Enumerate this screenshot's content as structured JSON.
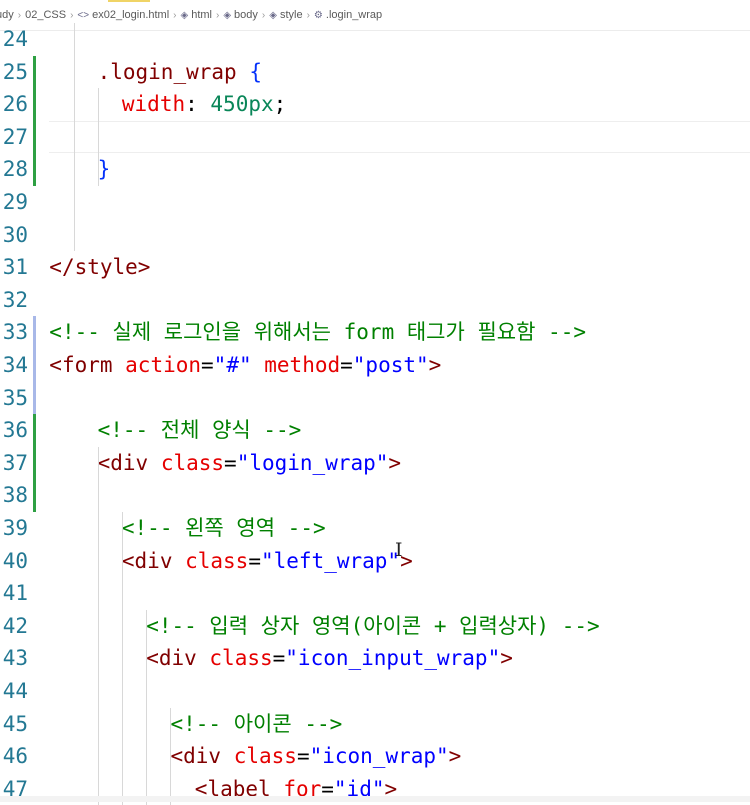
{
  "breadcrumb": {
    "items": [
      "udy",
      "02_CSS",
      "ex02_login.html",
      "html",
      "body",
      "style",
      ".login_wrap"
    ],
    "icons": [
      "",
      "",
      "html-file-icon",
      "element-icon",
      "element-icon",
      "element-icon",
      "selector-icon"
    ]
  },
  "theme": {
    "line_number_color": "#237893",
    "tag_color": "#800000",
    "attribute_color": "#e50000",
    "string_color": "#0000ff",
    "comment_color": "#008000",
    "number_color": "#098658",
    "modified_gutter_color": "#2ea043"
  },
  "editor": {
    "lines": [
      {
        "num": "24",
        "tokens": []
      },
      {
        "num": "25",
        "tokens": [
          {
            "t": ".login_wrap ",
            "c": "t-sel"
          },
          {
            "t": "{",
            "c": "t-brace"
          }
        ]
      },
      {
        "num": "26",
        "tokens": [
          {
            "t": "width",
            "c": "t-prop"
          },
          {
            "t": ": ",
            "c": "t-p"
          },
          {
            "t": "450px",
            "c": "t-num"
          },
          {
            "t": ";",
            "c": "t-p"
          }
        ]
      },
      {
        "num": "27",
        "tokens": []
      },
      {
        "num": "28",
        "tokens": [
          {
            "t": "}",
            "c": "t-brace"
          }
        ]
      },
      {
        "num": "29",
        "tokens": []
      },
      {
        "num": "30",
        "tokens": []
      },
      {
        "num": "31",
        "tokens": [
          {
            "t": "</style>",
            "c": "t-tag"
          }
        ]
      },
      {
        "num": "32",
        "tokens": []
      },
      {
        "num": "33",
        "tokens": [
          {
            "t": "<!-- 실제 로그인을 위해서는 form 태그가 필요함 -->",
            "c": "t-cmt"
          }
        ]
      },
      {
        "num": "34",
        "tokens": [
          {
            "t": "<form ",
            "c": "t-tag"
          },
          {
            "t": "action",
            "c": "t-attr"
          },
          {
            "t": "=",
            "c": "t-p"
          },
          {
            "t": "\"#\"",
            "c": "t-str"
          },
          {
            "t": " ",
            "c": "t-p"
          },
          {
            "t": "method",
            "c": "t-attr"
          },
          {
            "t": "=",
            "c": "t-p"
          },
          {
            "t": "\"post\"",
            "c": "t-str"
          },
          {
            "t": ">",
            "c": "t-tag"
          }
        ]
      },
      {
        "num": "35",
        "tokens": []
      },
      {
        "num": "36",
        "tokens": [
          {
            "t": "<!-- 전체 양식 -->",
            "c": "t-cmt"
          }
        ]
      },
      {
        "num": "37",
        "tokens": [
          {
            "t": "<div ",
            "c": "t-tag"
          },
          {
            "t": "class",
            "c": "t-attr"
          },
          {
            "t": "=",
            "c": "t-p"
          },
          {
            "t": "\"login_wrap\"",
            "c": "t-str"
          },
          {
            "t": ">",
            "c": "t-tag"
          }
        ]
      },
      {
        "num": "38",
        "tokens": []
      },
      {
        "num": "39",
        "tokens": [
          {
            "t": "<!-- 왼쪽 영역 -->",
            "c": "t-cmt"
          }
        ]
      },
      {
        "num": "40",
        "tokens": [
          {
            "t": "<div ",
            "c": "t-tag"
          },
          {
            "t": "class",
            "c": "t-attr"
          },
          {
            "t": "=",
            "c": "t-p"
          },
          {
            "t": "\"left_wrap\"",
            "c": "t-str"
          },
          {
            "t": ">",
            "c": "t-tag"
          }
        ]
      },
      {
        "num": "41",
        "tokens": []
      },
      {
        "num": "42",
        "tokens": [
          {
            "t": "<!-- 입력 상자 영역(아이콘 + 입력상자) -->",
            "c": "t-cmt"
          }
        ]
      },
      {
        "num": "43",
        "tokens": [
          {
            "t": "<div ",
            "c": "t-tag"
          },
          {
            "t": "class",
            "c": "t-attr"
          },
          {
            "t": "=",
            "c": "t-p"
          },
          {
            "t": "\"icon_input_wrap\"",
            "c": "t-str"
          },
          {
            "t": ">",
            "c": "t-tag"
          }
        ]
      },
      {
        "num": "44",
        "tokens": []
      },
      {
        "num": "45",
        "tokens": [
          {
            "t": "<!-- 아이콘 -->",
            "c": "t-cmt"
          }
        ]
      },
      {
        "num": "46",
        "tokens": [
          {
            "t": "<div ",
            "c": "t-tag"
          },
          {
            "t": "class",
            "c": "t-attr"
          },
          {
            "t": "=",
            "c": "t-p"
          },
          {
            "t": "\"icon_wrap\"",
            "c": "t-str"
          },
          {
            "t": ">",
            "c": "t-tag"
          }
        ]
      },
      {
        "num": "47",
        "tokens": [
          {
            "t": "<label ",
            "c": "t-tag"
          },
          {
            "t": "for",
            "c": "t-attr"
          },
          {
            "t": "=",
            "c": "t-p"
          },
          {
            "t": "\"id\"",
            "c": "t-str"
          },
          {
            "t": ">",
            "c": "t-tag"
          }
        ]
      }
    ]
  }
}
